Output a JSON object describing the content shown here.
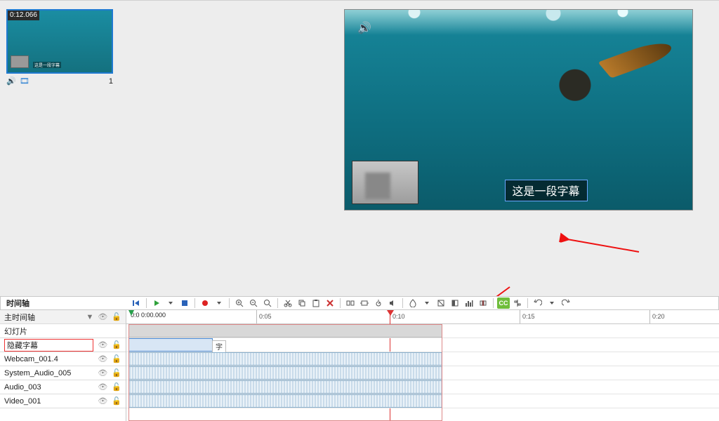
{
  "slide": {
    "timestamp": "0:12.066",
    "index": "1",
    "thumb_caption": "这是一段字幕"
  },
  "preview": {
    "caption": "这是一段字幕"
  },
  "panel": {
    "title": "时间轴"
  },
  "timebar": {
    "current": "0:0 0:00.000",
    "ticks": [
      "0:05",
      "0:10",
      "0:15",
      "0:20"
    ]
  },
  "tracks": {
    "master": "主时间轴",
    "rows": [
      {
        "name": "幻灯片"
      },
      {
        "name": "隐藏字幕"
      },
      {
        "name": "Webcam_001.4"
      },
      {
        "name": "System_Audio_005"
      },
      {
        "name": "Audio_003"
      },
      {
        "name": "Video_001"
      }
    ]
  },
  "subtitle_clip_label": "字幕",
  "toolbar": {
    "cc_label": "CC"
  },
  "colors": {
    "accent": "#1f7ad1",
    "cc_button": "#6fbd3b",
    "arrow": "#e11"
  }
}
